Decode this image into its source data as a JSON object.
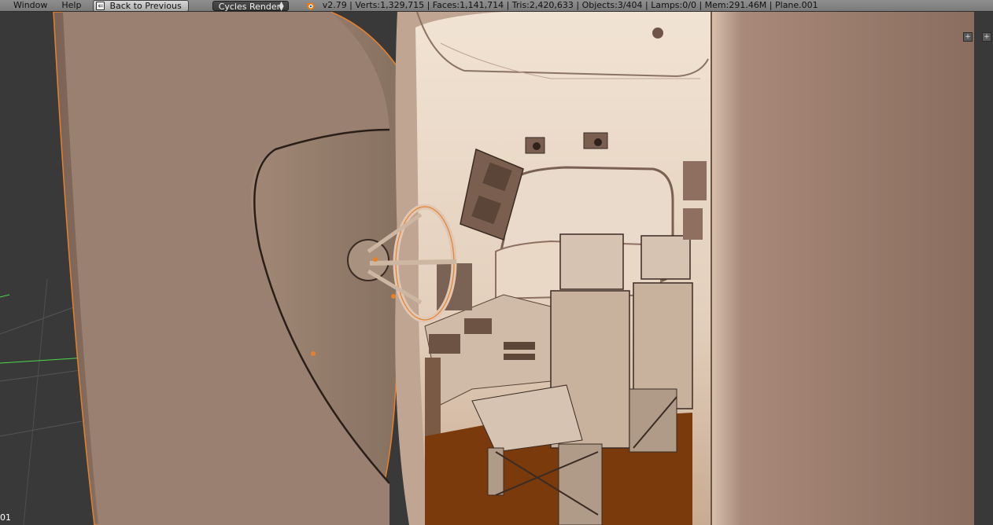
{
  "menu": {
    "window": "Window",
    "help": "Help"
  },
  "back_button": {
    "label": "Back to Previous"
  },
  "render_engine": {
    "selected": "Cycles Render"
  },
  "stats": "v2.79 | Verts:1,329,715 | Faces:1,141,714 | Tris:2,420,633 | Objects:3/404 | Lamps:0/0 | Mem:291.46M | Plane.001",
  "viewport": {
    "object_label": "01"
  },
  "colors": {
    "header": "#808080",
    "viewport_bg": "#393939",
    "model_shade": "#e8d5c4",
    "floor": "#7a3a0c",
    "selection_outline": "#e8802a"
  }
}
